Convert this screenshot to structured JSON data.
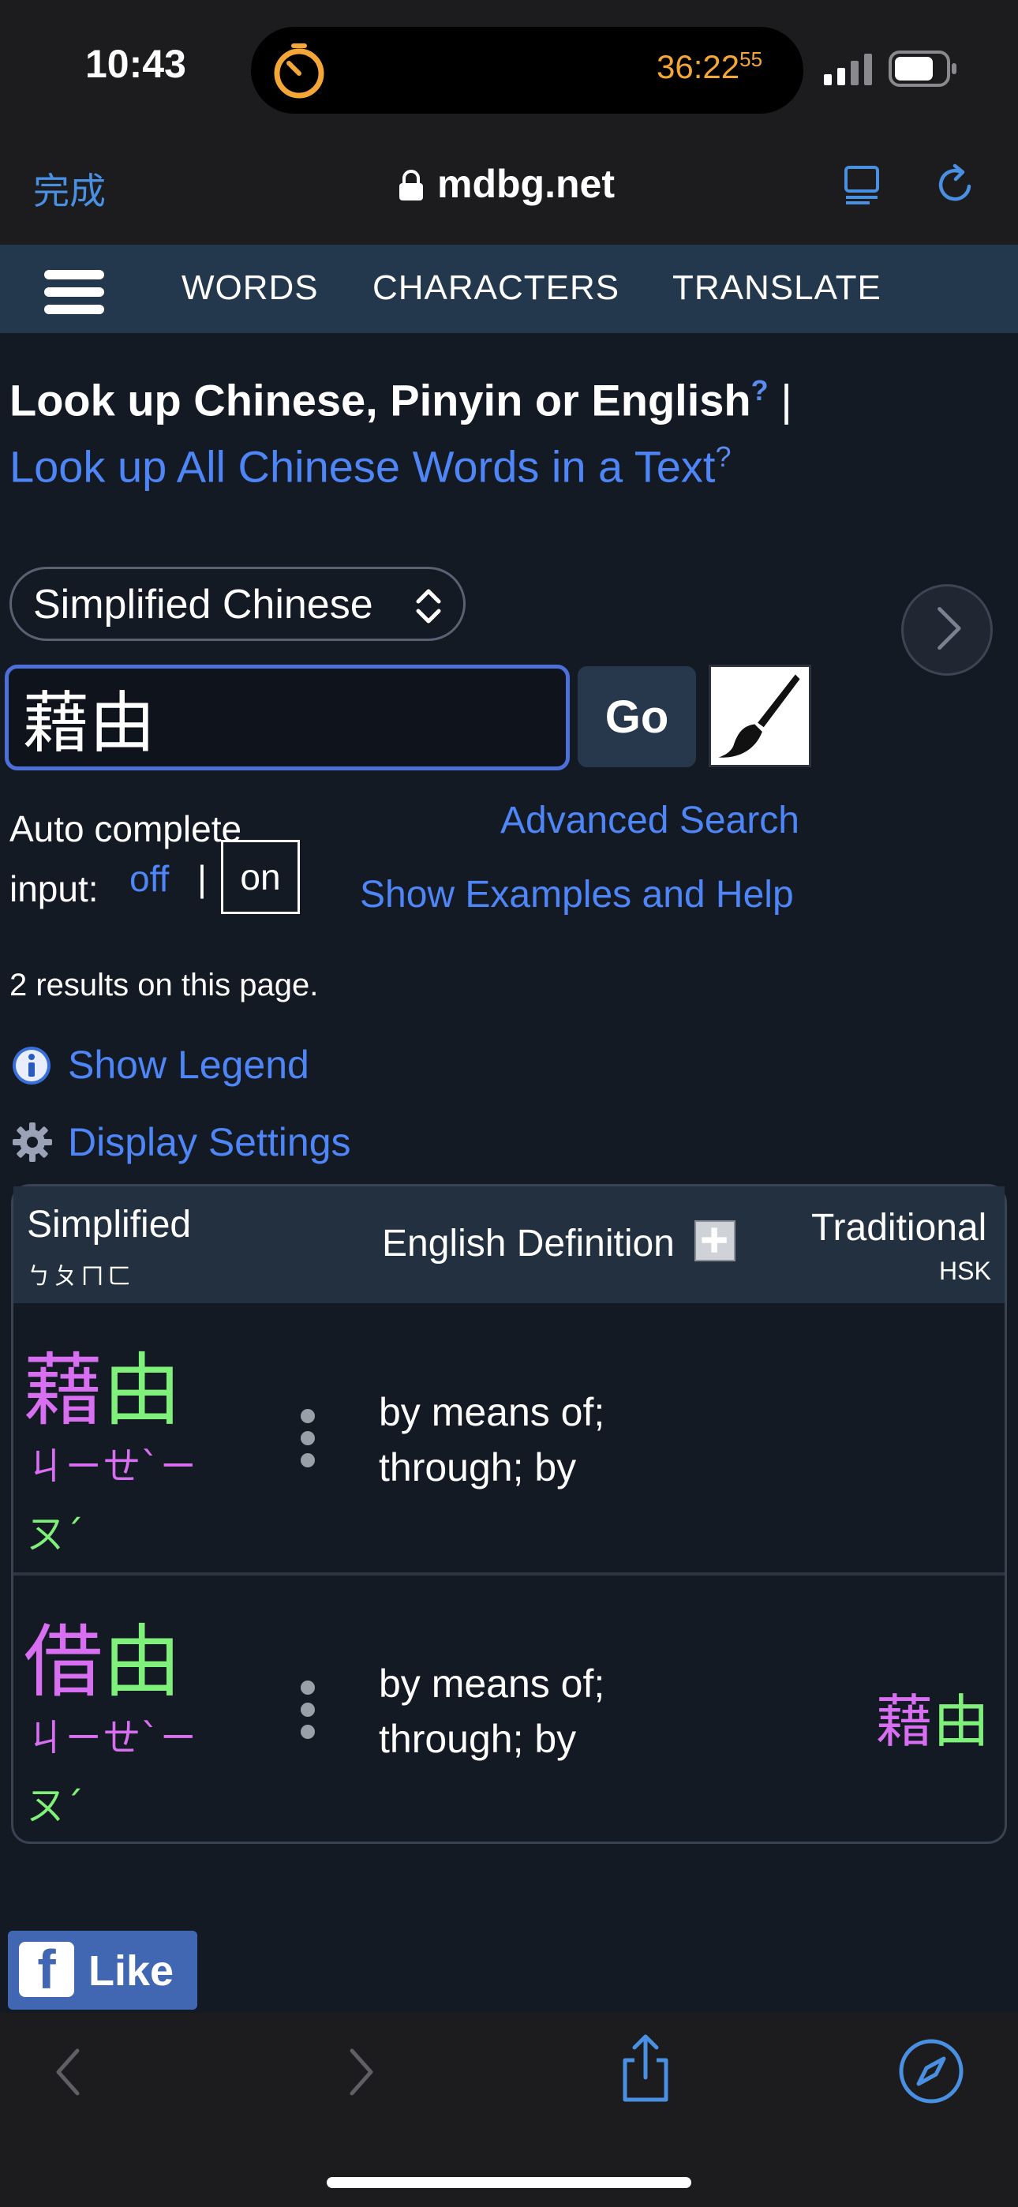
{
  "status_bar": {
    "time": "10:43",
    "timer": "36:22",
    "timer_fraction": "55"
  },
  "browser": {
    "done_label": "完成",
    "url": "mdbg.net"
  },
  "nav": {
    "items": [
      {
        "label": "WORDS"
      },
      {
        "label": "CHARACTERS"
      },
      {
        "label": "TRANSLATE"
      }
    ]
  },
  "page": {
    "heading": "Look up Chinese, Pinyin or English",
    "heading_help": "?",
    "heading_sep": "|",
    "text_link": "Look up All Chinese Words in a Text",
    "text_link_help": "?",
    "language_select": "Simplified Chinese",
    "search_value": "藉由",
    "go_label": "Go",
    "autocomplete_line1": "Auto complete",
    "autocomplete_line2": "input:",
    "autocomplete_off": "off",
    "autocomplete_sep": "|",
    "autocomplete_on": "on",
    "advanced_search": "Advanced Search",
    "examples_help": "Show Examples and Help",
    "results_count": "2 results on this page.",
    "show_legend": "Show Legend",
    "display_settings": "Display Settings"
  },
  "table": {
    "header": {
      "simplified": "Simplified",
      "bopomofo": "ㄅㄆㄇㄈ",
      "english": "English Definition",
      "traditional": "Traditional",
      "hsk": "HSK"
    },
    "rows": [
      {
        "hanzi_1": "藉",
        "hanzi_2": "由",
        "zhuyin_1": "ㄐㄧㄝˋㄧ",
        "zhuyin_2": "ㄡˊ",
        "def_line1": "by means of;",
        "def_line2": "through; by",
        "trad_1": "",
        "trad_2": ""
      },
      {
        "hanzi_1": "借",
        "hanzi_2": "由",
        "zhuyin_1": "ㄐㄧㄝˋㄧ",
        "zhuyin_2": "ㄡˊ",
        "def_line1": "by means of;",
        "def_line2": "through; by",
        "trad_1": "藉",
        "trad_2": "由"
      }
    ]
  },
  "facebook": {
    "f": "f",
    "like": "Like"
  },
  "colors": {
    "link": "#4f86f7",
    "tone4": "#d86ef0",
    "tone2": "#7ff07a",
    "nav_bg": "#24384d",
    "timer": "#f4a637"
  },
  "icons": [
    "timer-icon",
    "signal-icon",
    "battery-icon",
    "lock-icon",
    "reader-icon",
    "reload-icon",
    "menu-icon",
    "updown-icon",
    "chevron-right-icon",
    "brush-icon",
    "info-icon",
    "gear-icon",
    "plus-icon",
    "more-vertical-icon",
    "back-icon",
    "forward-icon",
    "share-icon",
    "compass-icon"
  ]
}
